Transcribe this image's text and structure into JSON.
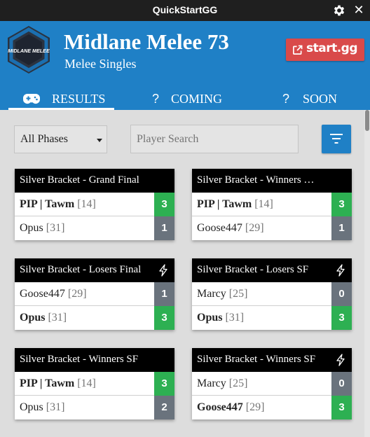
{
  "window": {
    "title": "QuickStartGG",
    "settings_icon": "gear-icon",
    "close_icon": "close-icon",
    "close_glyph": "✕"
  },
  "event": {
    "logo_text": "MIDLANE MELEE",
    "title": "Midlane Melee 73",
    "subtitle": "Melee Singles",
    "startgg_label": "start.gg",
    "startgg_icon": "external-link-icon"
  },
  "tabs": [
    {
      "label": "RESULTS",
      "icon": "gamepad-icon",
      "active": true
    },
    {
      "label": "COMING",
      "icon_glyph": "?",
      "active": false
    },
    {
      "label": "SOON",
      "icon_glyph": "?",
      "active": false
    }
  ],
  "filters": {
    "phase_value": "All Phases",
    "search_placeholder": "Player Search",
    "filter_icon": "filter-icon"
  },
  "colors": {
    "primary": "#1f80c6",
    "startgg": "#d94a4a",
    "win": "#2db052",
    "loss": "#6a737d",
    "card_header": "#000000"
  },
  "sets": [
    {
      "title": "Silver Bracket - Grand Final",
      "bolt": false,
      "p1": {
        "name": "PIP | Tawm",
        "seed": "[14]",
        "score": "3",
        "win": true
      },
      "p2": {
        "name": "Opus",
        "seed": "[31]",
        "score": "1",
        "win": false
      }
    },
    {
      "title": "Silver Bracket - Winners …",
      "bolt": false,
      "p1": {
        "name": "PIP | Tawm",
        "seed": "[14]",
        "score": "3",
        "win": true
      },
      "p2": {
        "name": "Goose447",
        "seed": "[29]",
        "score": "1",
        "win": false
      }
    },
    {
      "title": "Silver Bracket - Losers Final",
      "bolt": true,
      "p1": {
        "name": "Goose447",
        "seed": "[29]",
        "score": "1",
        "win": false
      },
      "p2": {
        "name": "Opus",
        "seed": "[31]",
        "score": "3",
        "win": true
      }
    },
    {
      "title": "Silver Bracket - Losers SF",
      "bolt": true,
      "p1": {
        "name": "Marcy",
        "seed": "[25]",
        "score": "0",
        "win": false
      },
      "p2": {
        "name": "Opus",
        "seed": "[31]",
        "score": "3",
        "win": true
      }
    },
    {
      "title": "Silver Bracket - Winners SF",
      "bolt": false,
      "p1": {
        "name": "PIP | Tawm",
        "seed": "[14]",
        "score": "3",
        "win": true
      },
      "p2": {
        "name": "Opus",
        "seed": "[31]",
        "score": "2",
        "win": false
      }
    },
    {
      "title": "Silver Bracket - Winners SF",
      "bolt": true,
      "p1": {
        "name": "Marcy",
        "seed": "[25]",
        "score": "0",
        "win": false
      },
      "p2": {
        "name": "Goose447",
        "seed": "[29]",
        "score": "3",
        "win": true
      }
    }
  ]
}
